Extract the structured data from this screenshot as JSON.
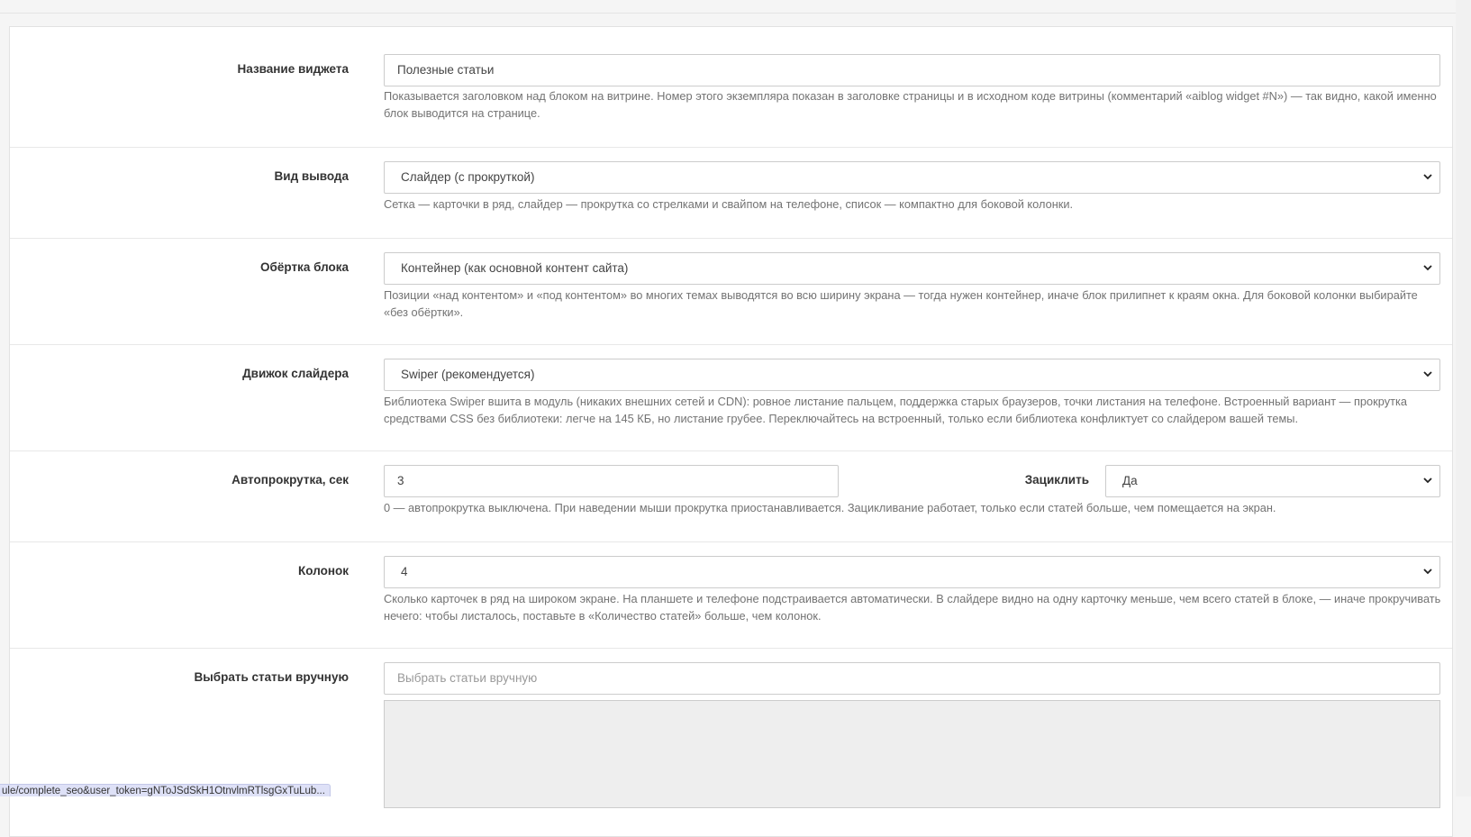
{
  "form": {
    "widget_name": {
      "label": "Название виджета",
      "value": "Полезные статьи",
      "help": "Показывается заголовком над блоком на витрине. Номер этого экземпляра показан в заголовке страницы и в исходном коде витрины (комментарий «aiblog widget #N») — так видно, какой именно блок выводится на странице."
    },
    "display_type": {
      "label": "Вид вывода",
      "selected": "Слайдер (с прокруткой)",
      "help": "Сетка — карточки в ряд, слайдер — прокрутка со стрелками и свайпом на телефоне, список — компактно для боковой колонки."
    },
    "wrapper": {
      "label": "Обёртка блока",
      "selected": "Контейнер (как основной контент сайта)",
      "help": "Позиции «над контентом» и «под контентом» во многих темах выводятся во всю ширину экрана — тогда нужен контейнер, иначе блок прилипнет к краям окна. Для боковой колонки выбирайте «без обёртки»."
    },
    "slider_engine": {
      "label": "Движок слайдера",
      "selected": "Swiper (рекомендуется)",
      "help": "Библиотека Swiper вшита в модуль (никаких внешних сетей и CDN): ровное листание пальцем, поддержка старых браузеров, точки листания на телефоне. Встроенный вариант — прокрутка средствами CSS без библиотеки: легче на 145 КБ, но листание грубее. Переключайтесь на встроенный, только если библиотека конфликтует со слайдером вашей темы."
    },
    "autoscroll": {
      "label": "Автопрокрутка, сек",
      "value": "3",
      "loop_label": "Зациклить",
      "loop_selected": "Да",
      "help": "0 — автопрокрутка выключена. При наведении мыши прокрутка приостанавливается. Зацикливание работает, только если статей больше, чем помещается на экран."
    },
    "columns": {
      "label": "Колонок",
      "selected": "4",
      "help": "Сколько карточек в ряд на широком экране. На планшете и телефоне подстраивается автоматически. В слайдере видно на одну карточку меньше, чем всего статей в блоке, — иначе прокручивать нечего: чтобы листалось, поставьте в «Количество статей» больше, чем колонок."
    },
    "manual_articles": {
      "label": "Выбрать статьи вручную",
      "placeholder": "Выбрать статьи вручную"
    }
  },
  "status_bar": {
    "url": "ule/complete_seo&user_token=gNToJSdSkH1OtnvlmRTlsgGxTuLub..."
  },
  "colors": {
    "label_text": "#333333",
    "help_text": "#737373",
    "border": "#cccccc",
    "panel_bg": "#ffffff",
    "page_bg": "#f5f5f5"
  }
}
